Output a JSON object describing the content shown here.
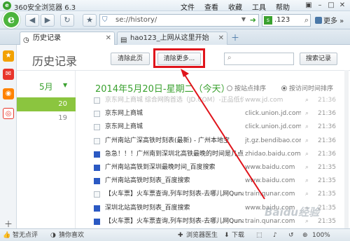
{
  "window": {
    "app_name": "360安全浏览器 6.3",
    "menu": [
      "文件",
      "查看",
      "收藏",
      "工具",
      "帮助"
    ]
  },
  "toolbar": {
    "address": "se://history/",
    "search_text": ".123",
    "more_label": "更多"
  },
  "tabs": [
    {
      "label": "历史记录",
      "active": true
    },
    {
      "label": "hao123_上网从这里开始",
      "active": false
    }
  ],
  "page": {
    "title": "历史记录",
    "clear_page_label": "清除此页",
    "clear_more_label": "清除更多...",
    "search_button_label": "搜索记录"
  },
  "calendar": {
    "month": "5月",
    "days": [
      "20",
      "19"
    ],
    "selected_day": "20"
  },
  "history": {
    "date_heading": "2014年5月20日-星期二（今天）",
    "sort_by_site_label": "按站点排序",
    "sort_by_time_label": "按访问时间排序",
    "sort_selected": "time",
    "rows": [
      {
        "title": "京东网上商城 综合网购首选（JD.COM）-正品低价、品",
        "url": "www.jd.com",
        "time": "21:36",
        "icon": "blank",
        "faded": true
      },
      {
        "title": "京东网上商城",
        "url": "click.union.jd.com",
        "time": "21:36",
        "icon": "blank",
        "faded": false
      },
      {
        "title": "京东网上商城",
        "url": "click.union.jd.com",
        "time": "21:36",
        "icon": "blank",
        "faded": false
      },
      {
        "title": "广州南站广深高铁时刻表(最新) - 广州本地宝",
        "url": "jt.gz.bendibao.com",
        "time": "21:36",
        "icon": "blank",
        "faded": false
      },
      {
        "title": "急急！！！广州南到深圳北高铁最晚的时间是几点...",
        "url": "zhidao.baidu.com",
        "time": "21:36",
        "icon": "baidu",
        "faded": false
      },
      {
        "title": "广州南站高铁到深圳最晚时间_百度搜索",
        "url": "www.baidu.com",
        "time": "21:35",
        "icon": "baidu",
        "faded": false
      },
      {
        "title": "广州南站高铁时刻表_百度搜索",
        "url": "www.baidu.com",
        "time": "21:35",
        "icon": "baidu",
        "faded": false
      },
      {
        "title": "【火车票】火车票查询,列车时刻表-去哪儿网Qunar...",
        "url": "train.qunar.com",
        "time": "21:35",
        "icon": "blank",
        "faded": false
      },
      {
        "title": "深圳北站高铁时刻表_百度搜索",
        "url": "www.baidu.com",
        "time": "21:35",
        "icon": "baidu",
        "faded": false
      },
      {
        "title": "【火车票】火车票查询,列车时刻表-去哪儿网Qunar...",
        "url": "train.qunar.com",
        "time": "21:35",
        "icon": "baidu",
        "faded": false
      }
    ]
  },
  "statusbar": {
    "rating": "智无点评",
    "guess": "猜你喜欢",
    "doctor": "浏览器医生",
    "download": "下载",
    "zoom": "100%"
  },
  "watermark": "Baidu经验",
  "colors": {
    "accent_green": "#3aa12f",
    "highlight_red": "#e0141b"
  }
}
